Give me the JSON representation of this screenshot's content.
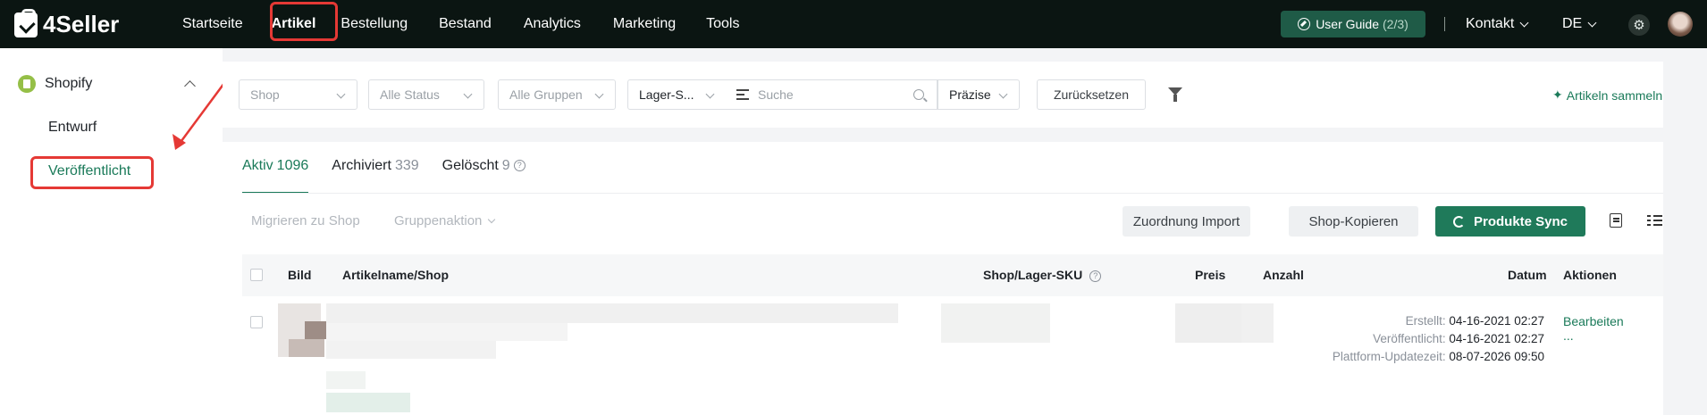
{
  "brand": {
    "name": "4Seller"
  },
  "nav": {
    "items": [
      "Startseite",
      "Artikel",
      "Bestellung",
      "Bestand",
      "Analytics",
      "Marketing",
      "Tools"
    ],
    "active": "Artikel"
  },
  "topbar": {
    "guide_label": "User Guide",
    "guide_count": "(2/3)",
    "contact_label": "Kontakt",
    "language": "DE"
  },
  "sidebar": {
    "shop_label": "Shopify",
    "items": [
      {
        "label": "Entwurf"
      },
      {
        "label": "Veröffentlicht"
      }
    ],
    "active": "Veröffentlicht"
  },
  "filters": {
    "shop_placeholder": "Shop",
    "status_placeholder": "Alle Status",
    "group_placeholder": "Alle Gruppen",
    "sku_type": "Lager-S...",
    "search_placeholder": "Suche",
    "match_mode": "Präzise",
    "reset_label": "Zurücksetzen",
    "collect_label": "Artikeln sammeln"
  },
  "tabs": [
    {
      "label": "Aktiv",
      "count": "1096"
    },
    {
      "label": "Archiviert",
      "count": "339"
    },
    {
      "label": "Gelöscht",
      "count": "9"
    }
  ],
  "actions": {
    "migrate_label": "Migrieren zu Shop",
    "group_action_label": "Gruppenaktion",
    "import_label": "Zuordnung Import",
    "copy_label": "Shop-Kopieren",
    "sync_label": "Produkte Sync"
  },
  "table": {
    "columns": {
      "image": "Bild",
      "name": "Artikelname/Shop",
      "sku": "Shop/Lager-SKU",
      "price": "Preis",
      "quantity": "Anzahl",
      "date": "Datum",
      "actions": "Aktionen"
    },
    "rows": [
      {
        "created_label": "Erstellt:",
        "created": "04-16-2021 02:27",
        "published_label": "Veröffentlicht:",
        "published": "04-16-2021 02:27",
        "updated_label": "Plattform-Updatezeit:",
        "updated": "08-07-2026 09:50",
        "edit_label": "Bearbeiten",
        "more_label": "..."
      }
    ]
  },
  "colors": {
    "topbar_bg": "#0b1512",
    "accent": "#1a7a59",
    "highlight": "#e53935"
  }
}
